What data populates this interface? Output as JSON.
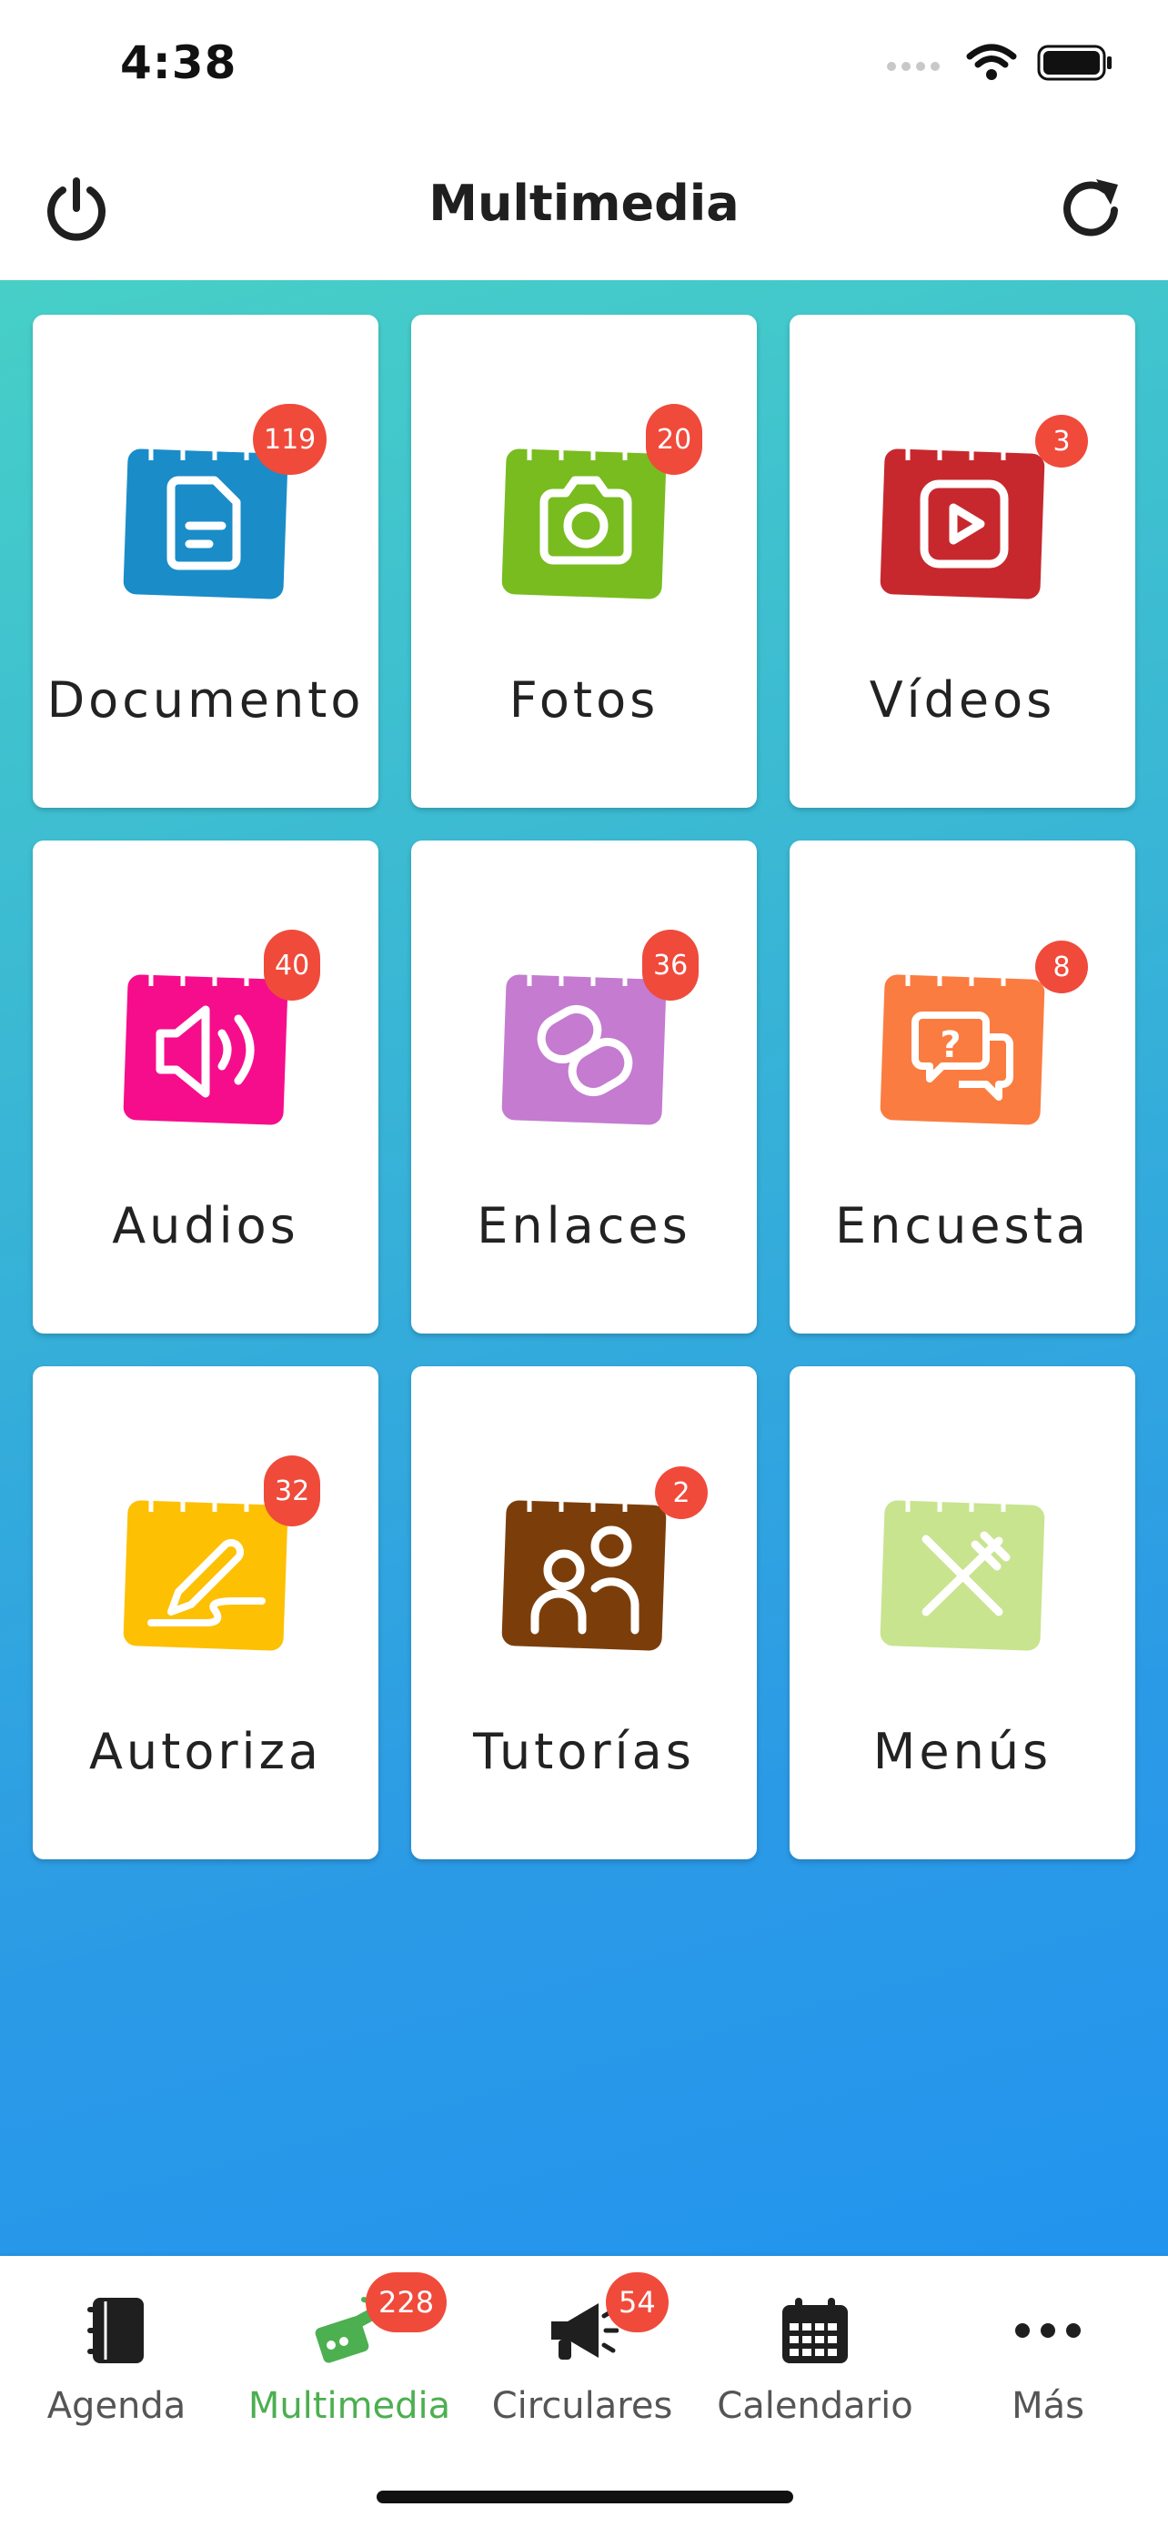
{
  "status_bar": {
    "time": "4:38"
  },
  "header": {
    "title": "Multimedia",
    "left_icon": "power-icon",
    "right_icon": "refresh-icon"
  },
  "tiles": [
    {
      "label": "Documento",
      "badge": "119",
      "color": "#1a8cc8",
      "icon": "document-icon"
    },
    {
      "label": "Fotos",
      "badge": "20",
      "color": "#78bc20",
      "icon": "camera-icon"
    },
    {
      "label": "Vídeos",
      "badge": "3",
      "color": "#c7282d",
      "icon": "video-play-icon"
    },
    {
      "label": "Audios",
      "badge": "40",
      "color": "#f60d8c",
      "icon": "speaker-icon"
    },
    {
      "label": "Enlaces",
      "badge": "36",
      "color": "#c47bd0",
      "icon": "link-icon"
    },
    {
      "label": "Encuesta",
      "badge": "8",
      "color": "#fb7c40",
      "icon": "question-chat-icon"
    },
    {
      "label": "Autoriza",
      "badge": "32",
      "color": "#fdc003",
      "icon": "signature-pen-icon"
    },
    {
      "label": "Tutorías",
      "badge": "2",
      "color": "#7b3e0b",
      "icon": "people-icon"
    },
    {
      "label": "Menús",
      "badge": "",
      "color": "#c8e48e",
      "icon": "fork-knife-icon"
    }
  ],
  "tabs": [
    {
      "label": "Agenda",
      "badge": "",
      "icon": "notebook-icon",
      "active": false
    },
    {
      "label": "Multimedia",
      "badge": "228",
      "icon": "multimedia-icon",
      "active": true
    },
    {
      "label": "Circulares",
      "badge": "54",
      "icon": "megaphone-icon",
      "active": false
    },
    {
      "label": "Calendario",
      "badge": "",
      "icon": "calendar-icon",
      "active": false
    },
    {
      "label": "Más",
      "badge": "",
      "icon": "more-dots-icon",
      "active": false
    }
  ],
  "colors": {
    "accent_green": "#4caf50",
    "badge_red": "#f04a3b",
    "gradient_top": "#47cfc7",
    "gradient_bottom": "#2294ee"
  }
}
